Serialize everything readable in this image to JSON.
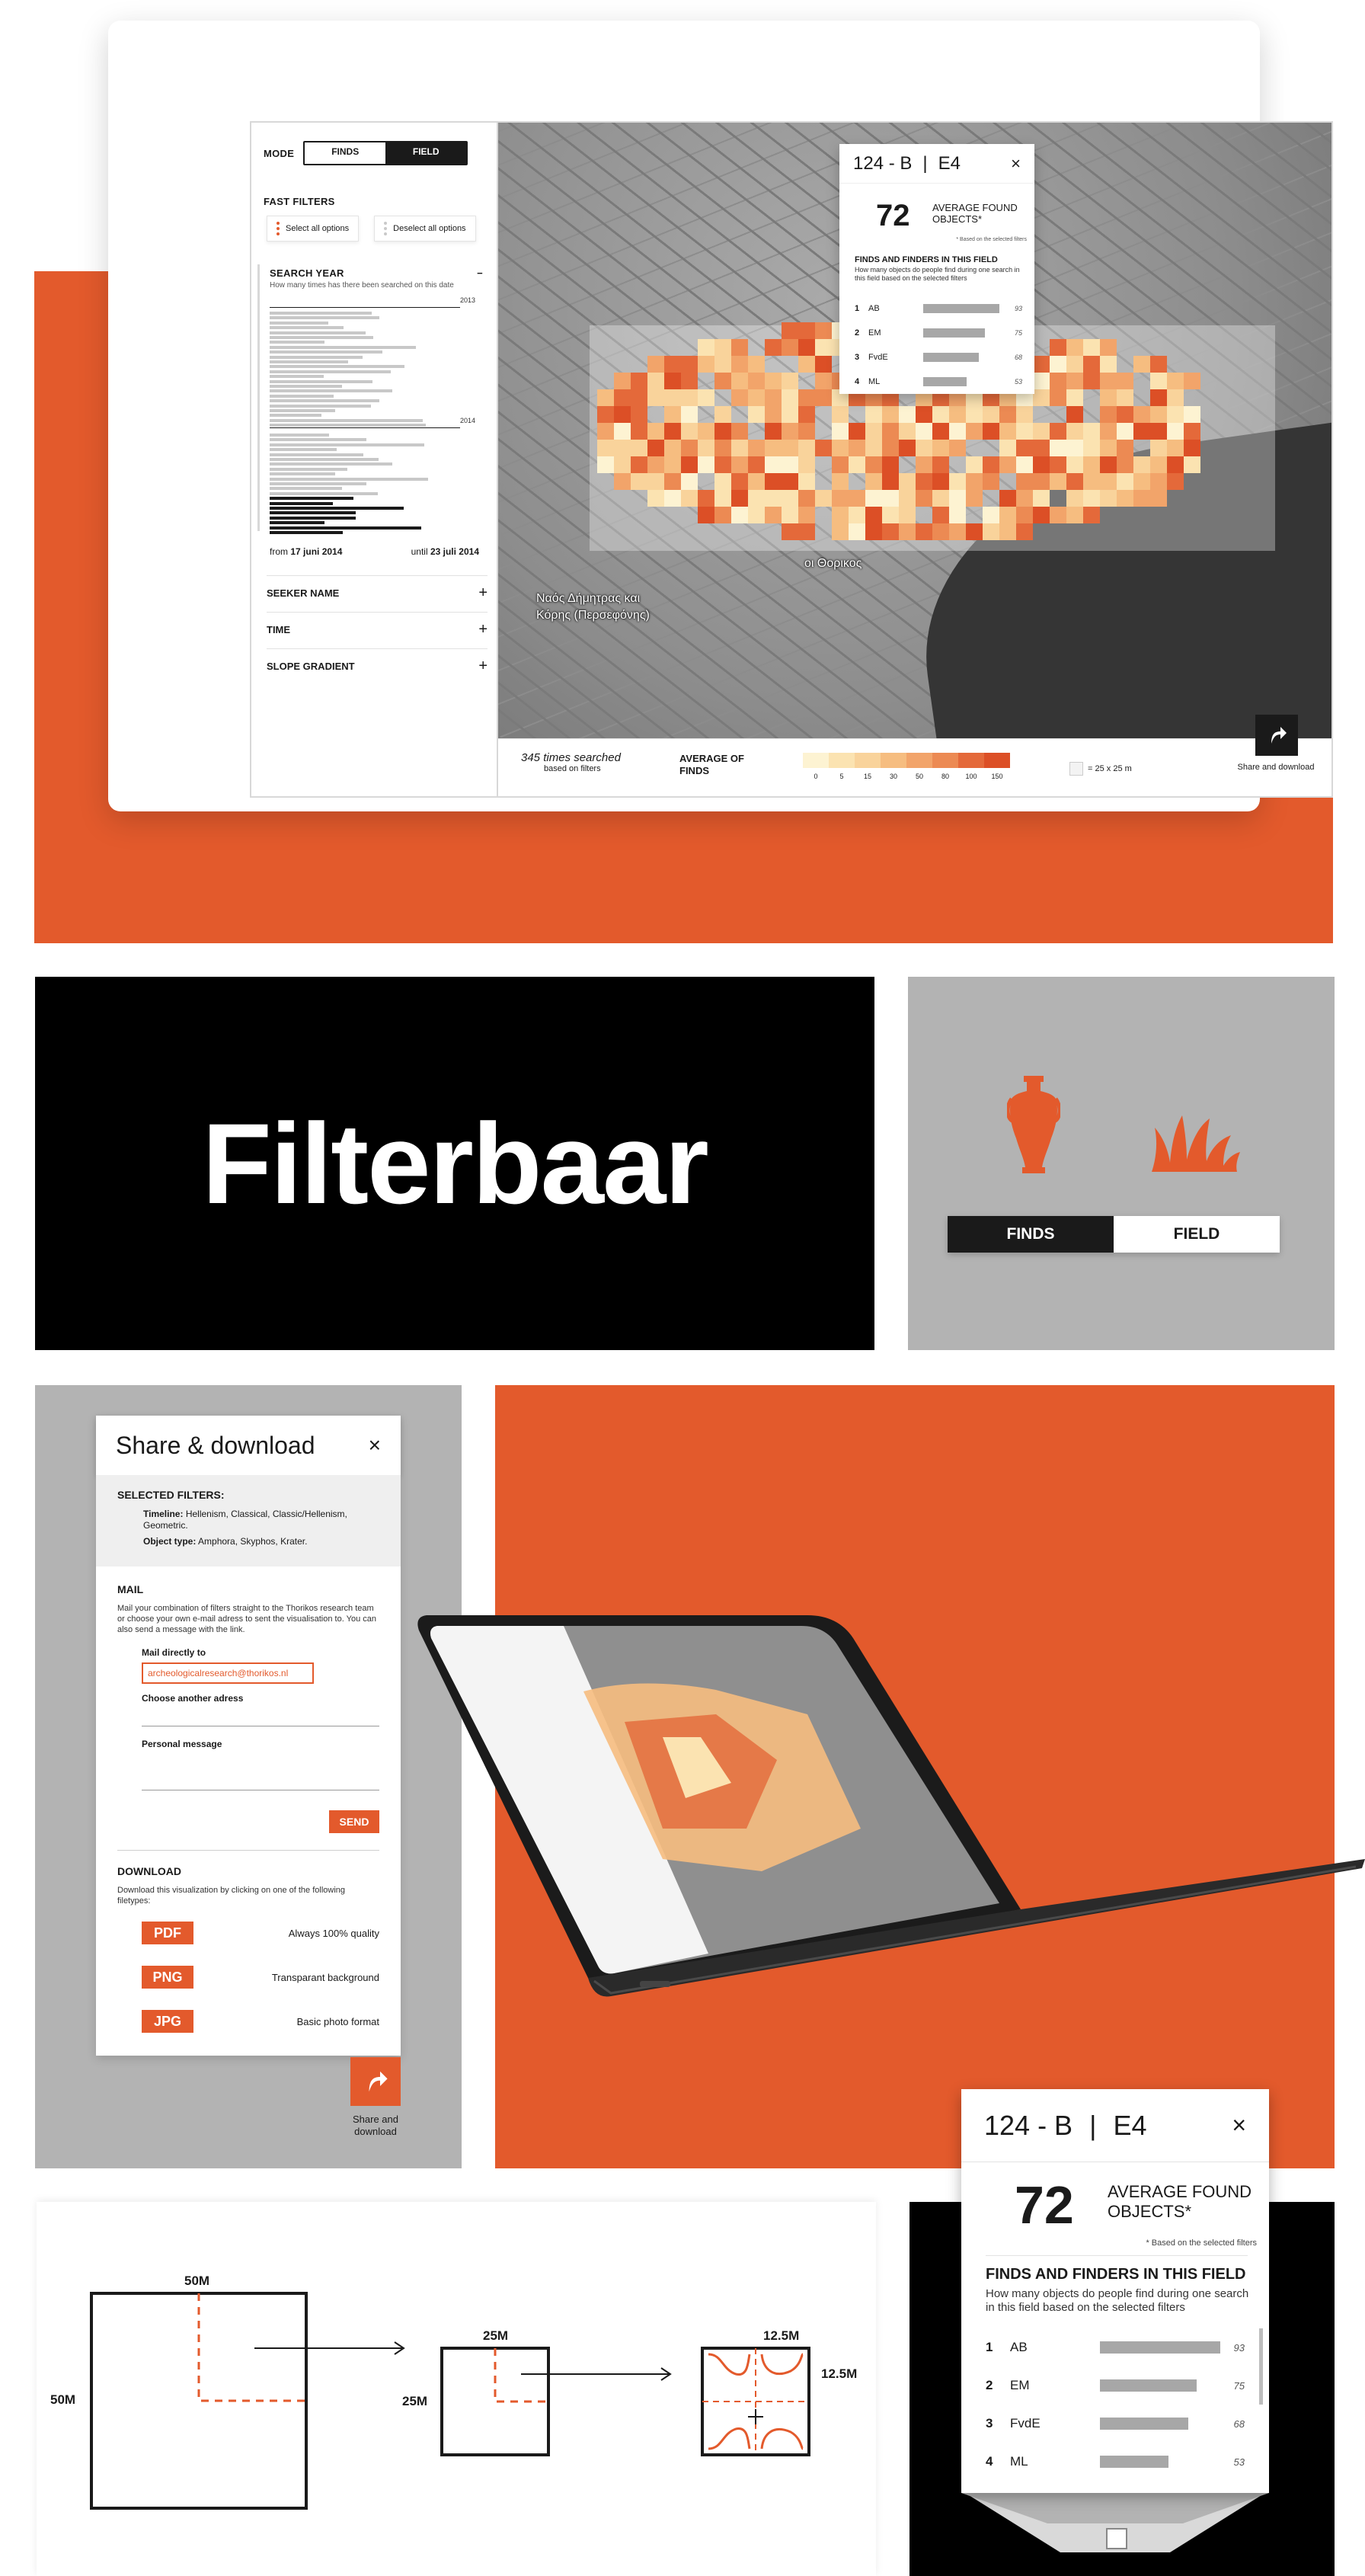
{
  "colors": {
    "accent": "#e35a2c",
    "dark": "#1a1a1a",
    "grey_panel": "#b3b3b3",
    "heat_scale": [
      "#fdf3d2",
      "#fbe3b1",
      "#f9d39b",
      "#f6bd80",
      "#f2a46a",
      "#ec8a53",
      "#e4693a",
      "#dc4f26"
    ]
  },
  "main_ui": {
    "mode_label": "MODE",
    "mode_tabs": [
      "FINDS",
      "FIELD"
    ],
    "mode_active": "FIELD",
    "fast_filters_title": "FAST FILTERS",
    "select_all": "Select all options",
    "deselect_all": "Deselect all options",
    "search_year": {
      "title": "SEARCH YEAR",
      "collapse_icon": "−",
      "subtitle": "How many times has there been searched on this date",
      "years": [
        "2013",
        "2014"
      ],
      "from_prefix": "from",
      "from_date": "17 juni 2014",
      "until_prefix": "until",
      "until_date": "23 juli 2014"
    },
    "filters": [
      {
        "label": "SEEKER NAME",
        "icon": "+"
      },
      {
        "label": "TIME",
        "icon": "+"
      },
      {
        "label": "SLOPE GRADIENT",
        "icon": "+"
      }
    ],
    "map_labels": [
      "Ναός Δήμητρας και",
      "Κόρης (Περσεφόνης)",
      "οι Θορικος"
    ],
    "footer": {
      "search_count": "345 times searched",
      "search_sub": "based on filters",
      "average_label": "AVERAGE OF FINDS",
      "scale_ticks": [
        "0",
        "5",
        "15",
        "30",
        "50",
        "80",
        "100",
        "150"
      ],
      "cell_size": "= 25 x 25 m",
      "share_label": "Share and download",
      "share_icon": "share-arrow-icon"
    }
  },
  "field_popup": {
    "field_code": "124 - B",
    "separator": "|",
    "cell_code": "E4",
    "close": "×",
    "average_value": "72",
    "average_label": "AVERAGE FOUND OBJECTS*",
    "note": "* Based on the selected filters",
    "finders_title": "FINDS AND FINDERS IN THIS FIELD",
    "finders_sub": "How many objects do people find during one search in this field based on the selected filters",
    "finders": [
      {
        "rank": "1",
        "code": "AB",
        "value": 93
      },
      {
        "rank": "2",
        "code": "EM",
        "value": 75
      },
      {
        "rank": "3",
        "code": "FvdE",
        "value": 68
      },
      {
        "rank": "4",
        "code": "ML",
        "value": 53
      }
    ]
  },
  "title_block": {
    "title": "Filterbaar",
    "toggle": [
      "FINDS",
      "FIELD"
    ],
    "icons": [
      "amphora-icon",
      "grass-icon"
    ]
  },
  "share_panel": {
    "title": "Share & download",
    "close": "×",
    "selected_filters_title": "SELECTED FILTERS:",
    "timeline_label": "Timeline:",
    "timeline_value": "Hellenism, Classical, Classic/Hellenism, Geometric.",
    "object_label": "Object type:",
    "object_value": "Amphora, Skyphos, Krater.",
    "mail_title": "MAIL",
    "mail_desc": "Mail your combination of filters straight to the Thorikos research team or choose your own e-mail adress to sent the visualisation to. You can also send a message with the link.",
    "mail_direct_label": "Mail directly to",
    "mail_direct_value": "archeologicalresearch@thorikos.nl",
    "other_address_label": "Choose another adress",
    "message_label": "Personal message",
    "send": "SEND",
    "download_title": "DOWNLOAD",
    "download_desc": "Download this visualization by clicking on one of the following filetypes:",
    "formats": [
      {
        "type": "PDF",
        "desc": "Always 100% quality"
      },
      {
        "type": "PNG",
        "desc": "Transparant background"
      },
      {
        "type": "JPG",
        "desc": "Basic photo format"
      }
    ],
    "share_label": "Share and download"
  },
  "grid_diagram": {
    "big_top": "50M",
    "big_side": "50M",
    "mid_top": "25M",
    "mid_side": "25M",
    "small_top": "12.5M",
    "small_side": "12.5M"
  }
}
